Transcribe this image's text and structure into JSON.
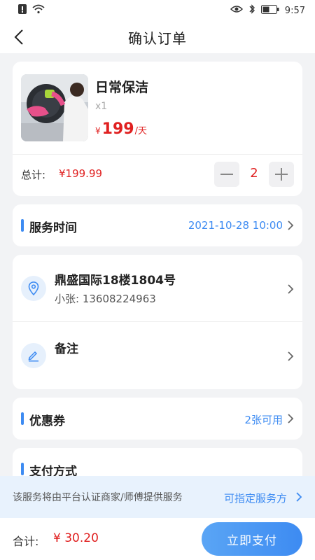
{
  "status_bar": {
    "time": "9:57",
    "icons": [
      "alert-icon",
      "wifi-icon",
      "eye-icon",
      "bluetooth-icon",
      "battery-icon"
    ]
  },
  "nav": {
    "title": "确认订单",
    "back_icon": "back-arrow-icon"
  },
  "product": {
    "name": "日常保洁",
    "quantity": "x1",
    "price_symbol": "¥",
    "price": "199",
    "price_unit": "/天",
    "total_label": "总计:",
    "total_value": "¥199.99",
    "stepper_value": "2"
  },
  "service_time": {
    "title": "服务时间",
    "value": "2021-10-28 10:00"
  },
  "address": {
    "title": "鼎盛国际18楼1804号",
    "contact": "小张: 13608224963"
  },
  "remark": {
    "title": "备注"
  },
  "coupon": {
    "title": "优惠券",
    "value": "2张可用"
  },
  "payment": {
    "title": "支付方式"
  },
  "notice": {
    "text": "该服务将由平台认证商家/师傅提供服务",
    "link": "可指定服务方"
  },
  "bottom": {
    "sum_label": "合计:",
    "sum_value": "¥ 30.20",
    "pay_button": "立即支付"
  },
  "colors": {
    "accent": "#3d8bf2",
    "price": "#e02020",
    "background": "#f2f3f5"
  }
}
